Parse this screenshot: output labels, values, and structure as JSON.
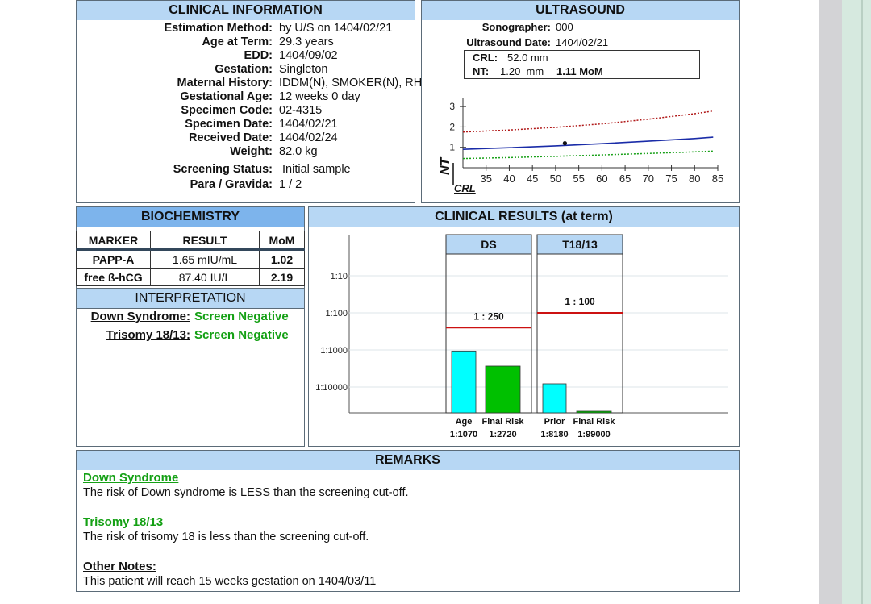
{
  "clinical_info": {
    "title": "CLINICAL INFORMATION",
    "rows": [
      {
        "label": "Estimation Method:",
        "value": "by U/S on 1404/02/21"
      },
      {
        "label": "Age at Term:",
        "value": "29.3 years"
      },
      {
        "label": "EDD:",
        "value": "1404/09/02"
      },
      {
        "label": "Gestation:",
        "value": "Singleton"
      },
      {
        "label": "Maternal History:",
        "value": "IDDM(N), SMOKER(N), RH(U), IVF(N)"
      },
      {
        "label": "Gestational Age:",
        "value": "12 weeks 0 day"
      },
      {
        "label": "Specimen Code:",
        "value": "02-4315"
      },
      {
        "label": "Specimen Date:",
        "value": "1404/02/21"
      },
      {
        "label": "Received Date:",
        "value": "1404/02/24"
      },
      {
        "label": "Weight:",
        "value": "82.0 kg"
      }
    ],
    "extra_rows": [
      {
        "label": "Screening Status:",
        "value": "Initial sample"
      },
      {
        "label": "Para / Gravida:",
        "value": "1 / 2"
      }
    ]
  },
  "ultrasound": {
    "title": "ULTRASOUND",
    "sonographer_label": "Sonographer:",
    "sonographer": "000",
    "date_label": "Ultrasound Date:",
    "date": "1404/02/21",
    "crl_label": "CRL:",
    "crl": "52.0 mm",
    "nt_label": "NT:",
    "nt": "1.20  mm",
    "nt_mom": "1.11 MoM",
    "chart_data": {
      "type": "line",
      "xlabel": "CRL",
      "ylabel": "NT",
      "xlim": [
        30,
        85
      ],
      "ylim": [
        0,
        3.4
      ],
      "x_ticks": [
        35,
        40,
        45,
        50,
        55,
        60,
        65,
        70,
        75,
        80,
        85
      ],
      "y_ticks": [
        1,
        2,
        3
      ],
      "series": [
        {
          "color": "#b01818",
          "style": "dotted",
          "x": [
            30,
            40,
            50,
            60,
            70,
            80,
            84
          ],
          "y": [
            1.75,
            1.85,
            1.98,
            2.15,
            2.38,
            2.65,
            2.78
          ]
        },
        {
          "color": "#1a2ca8",
          "style": "solid",
          "x": [
            30,
            40,
            50,
            60,
            70,
            80,
            84
          ],
          "y": [
            0.9,
            0.98,
            1.07,
            1.18,
            1.3,
            1.43,
            1.5
          ]
        },
        {
          "color": "#17a017",
          "style": "dotted",
          "x": [
            30,
            40,
            50,
            60,
            70,
            80,
            84
          ],
          "y": [
            0.45,
            0.5,
            0.56,
            0.63,
            0.7,
            0.78,
            0.82
          ]
        }
      ],
      "point": {
        "x": 52.0,
        "y": 1.2
      }
    }
  },
  "biochemistry": {
    "title": "BIOCHEMISTRY",
    "headers": [
      "MARKER",
      "RESULT",
      "MoM"
    ],
    "rows": [
      {
        "marker": "PAPP-A",
        "result": "1.65 mIU/mL",
        "mom": "1.02"
      },
      {
        "marker": "free ß-hCG",
        "result": "87.40 IU/L",
        "mom": "2.19"
      }
    ]
  },
  "interpretation": {
    "title": "INTERPRETATION",
    "rows": [
      {
        "label": "Down Syndrome:",
        "value": "Screen Negative"
      },
      {
        "label": "Trisomy 18/13:",
        "value": "Screen Negative"
      }
    ]
  },
  "clinical_results": {
    "title": "CLINICAL RESULTS (at term)",
    "chart_data": {
      "type": "bar",
      "scale": "log-risk",
      "y_ticks": [
        "1:10",
        "1:100",
        "1:1000",
        "1:10000"
      ],
      "groups": [
        {
          "name": "DS",
          "cutoff_label": "1 : 250",
          "cutoff_denominator": 250,
          "bars": [
            {
              "label": "Age",
              "value_label": "1:1070",
              "denominator": 1070,
              "color": "#00ffff"
            },
            {
              "label": "Final Risk",
              "value_label": "1:2720",
              "denominator": 2720,
              "color": "#00c000"
            }
          ]
        },
        {
          "name": "T18/13",
          "cutoff_label": "1 : 100",
          "cutoff_denominator": 100,
          "bars": [
            {
              "label": "Prior",
              "value_label": "1:8180",
              "denominator": 8180,
              "color": "#00ffff"
            },
            {
              "label": "Final Risk",
              "value_label": "1:99000",
              "denominator": 99000,
              "color": "#00c000"
            }
          ]
        }
      ]
    }
  },
  "remarks": {
    "title": "REMARKS",
    "sections": [
      {
        "heading": "Down Syndrome",
        "text": "The risk of Down syndrome is LESS than the screening cut-off.",
        "color": "#14a014"
      },
      {
        "heading": "Trisomy 18/13",
        "text": "The risk of trisomy 18 is less than the screening cut-off.",
        "color": "#14a014"
      },
      {
        "heading": "Other Notes:",
        "text": "This patient will reach 15 weeks gestation on 1404/03/11",
        "color": "#111111"
      }
    ]
  }
}
